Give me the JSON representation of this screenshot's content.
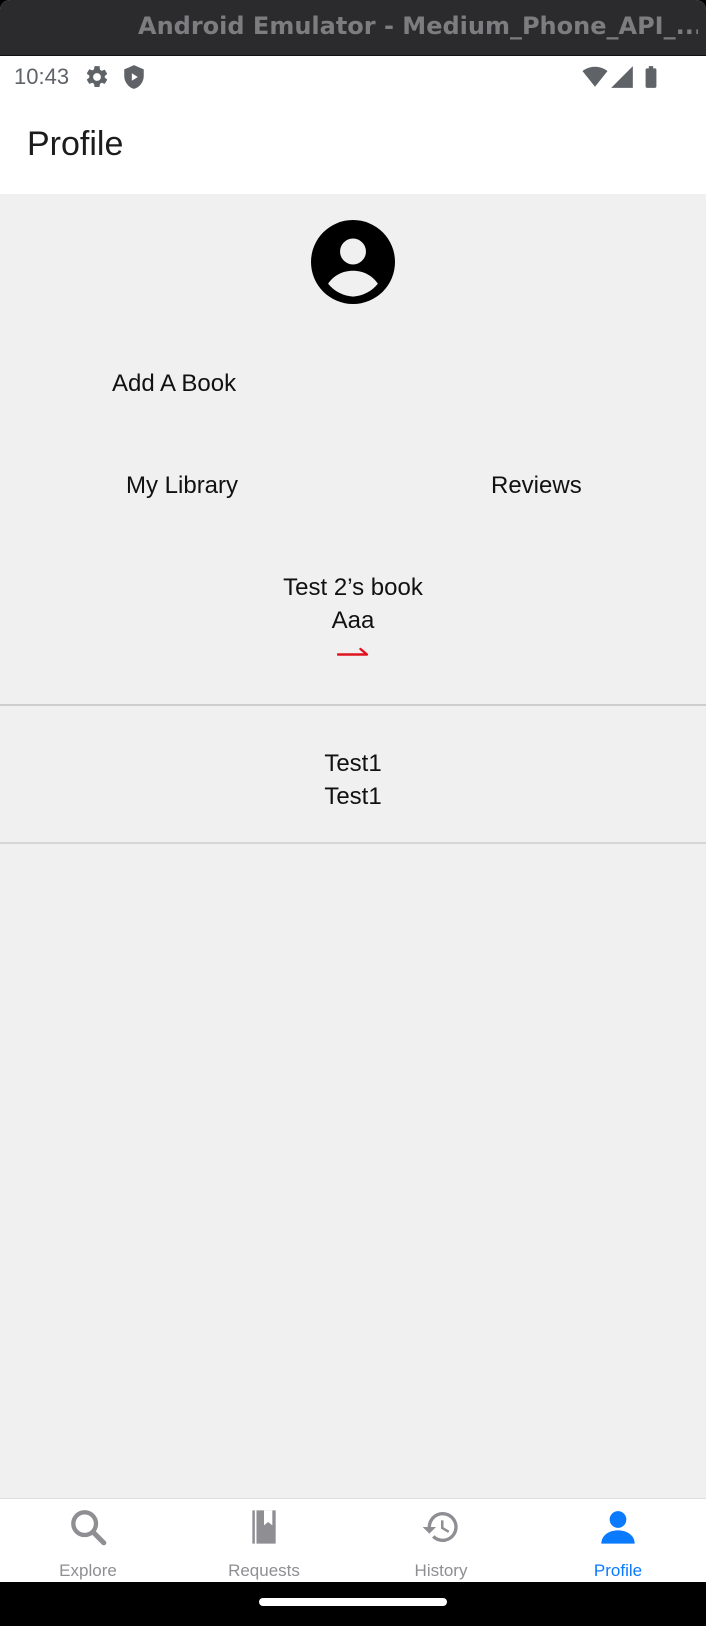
{
  "window": {
    "title": "Android Emulator - Medium_Phone_API_..."
  },
  "status_bar": {
    "time": "10:43",
    "left_icons": [
      "gear-icon",
      "shield-icon"
    ],
    "right_icons": [
      "wifi-icon",
      "signal-icon",
      "battery-icon"
    ]
  },
  "app_bar": {
    "title": "Profile"
  },
  "profile": {
    "avatar_icon": "account-circle-icon",
    "add_book_label": "Add A Book",
    "my_library_label": "My Library",
    "reviews_label": "Reviews"
  },
  "library_items": [
    {
      "title": "Test 2’s book",
      "author": "Aaa",
      "arrow_icon": "arrow-right-icon",
      "arrow_color": "#e0141e"
    }
  ],
  "review_items": [
    {
      "line1": "Test1",
      "line2": "Test1"
    }
  ],
  "tab_bar": {
    "active_color": "#0a7aff",
    "inactive_color": "#8e8e93",
    "tabs": [
      {
        "label": "Explore",
        "icon": "search-icon",
        "active": false
      },
      {
        "label": "Requests",
        "icon": "book-icon",
        "active": false
      },
      {
        "label": "History",
        "icon": "history-icon",
        "active": false
      },
      {
        "label": "Profile",
        "icon": "person-icon",
        "active": true
      }
    ]
  }
}
